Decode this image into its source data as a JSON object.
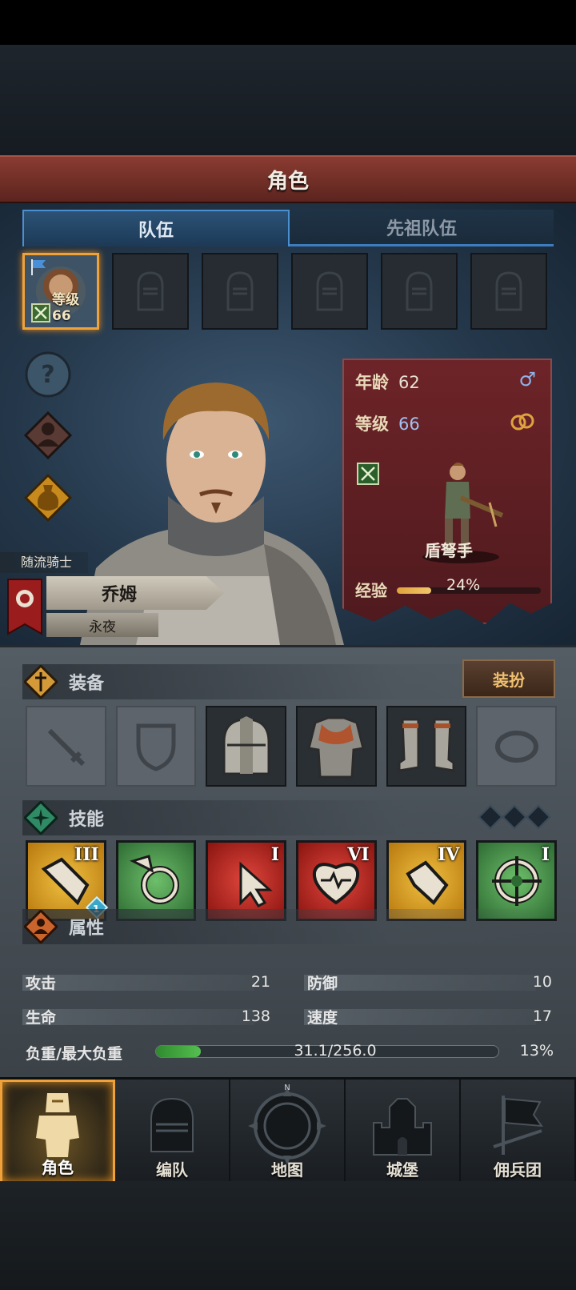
{
  "header": {
    "title": "角色"
  },
  "tabs": [
    {
      "label": "队伍",
      "active": true
    },
    {
      "label": "先祖队伍",
      "active": false
    }
  ],
  "party": {
    "active_level_label": "等级66",
    "slot_count": 6
  },
  "character": {
    "title": "随流骑士",
    "name": "乔姆",
    "faction": "永夜",
    "class_name": "盾弩手",
    "age_label": "年龄",
    "age": "62",
    "level_label": "等级",
    "level": "66",
    "exp_label": "经验",
    "exp_percent": "24%",
    "exp_fraction": 0.24,
    "gender_icon": "♂",
    "trait_icon": "rings-icon"
  },
  "equipment": {
    "label": "装备",
    "dress_button": "装扮",
    "slots": [
      "weapon-empty",
      "shield-empty",
      "helmet",
      "chainmail-armor",
      "boots",
      "ring-empty"
    ]
  },
  "skills": {
    "label": "技能",
    "items": [
      {
        "icon": "shield-bash-icon",
        "rank": "III",
        "color": "#d9a21c",
        "gem": "1"
      },
      {
        "icon": "crosshair-shot-icon",
        "rank": "",
        "color": "#3f8f45"
      },
      {
        "icon": "pointer-strike-icon",
        "rank": "I",
        "color": "#b7231f"
      },
      {
        "icon": "heart-pulse-icon",
        "rank": "VI",
        "color": "#b7231f"
      },
      {
        "icon": "shield-block-icon",
        "rank": "IV",
        "color": "#d9a21c"
      },
      {
        "icon": "target-icon",
        "rank": "I",
        "color": "#3f8f45"
      }
    ]
  },
  "attributes": {
    "label": "属性",
    "attack_label": "攻击",
    "attack": "21",
    "defense_label": "防御",
    "defense": "10",
    "hp_label": "生命",
    "hp": "138",
    "speed_label": "速度",
    "speed": "17",
    "load_label": "负重/最大负重",
    "load_value": "31.1/256.0",
    "load_percent": "13%",
    "load_fraction": 0.13
  },
  "nav": [
    {
      "label": "角色",
      "icon": "knight-icon",
      "active": true
    },
    {
      "label": "编队",
      "icon": "helmet-icon",
      "active": false
    },
    {
      "label": "地图",
      "icon": "compass-icon",
      "active": false
    },
    {
      "label": "城堡",
      "icon": "castle-icon",
      "active": false
    },
    {
      "label": "佣兵团",
      "icon": "banner-icon",
      "active": false
    }
  ],
  "colors": {
    "accent": "#f0a23a",
    "title_bar": "#8a3b31",
    "tab_active": "#4a8fd0",
    "card": "#6d2428"
  }
}
